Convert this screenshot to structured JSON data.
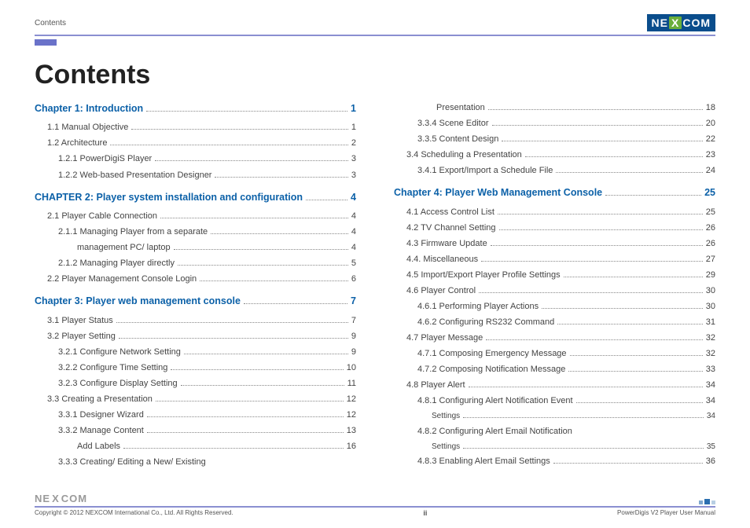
{
  "header": {
    "label": "Contents"
  },
  "logo": {
    "pre": "NE",
    "x": "X",
    "post": "COM"
  },
  "title": "Contents",
  "toc_left": [
    {
      "label": "Chapter 1: Introduction",
      "page": "1",
      "cls": "chapter"
    },
    {
      "label": "1.1 Manual Objective",
      "page": "1",
      "cls": "lvl1"
    },
    {
      "label": "1.2 Architecture",
      "page": "2",
      "cls": "lvl1"
    },
    {
      "label": "1.2.1 PowerDigiS Player",
      "page": "3",
      "cls": "lvl2"
    },
    {
      "label": "1.2.2 Web-based Presentation Designer",
      "page": "3",
      "cls": "lvl2"
    },
    {
      "label": "CHAPTER 2: Player system installation and configuration",
      "page": "4",
      "cls": "chapter"
    },
    {
      "label": "2.1 Player Cable Connection",
      "page": "4",
      "cls": "lvl1"
    },
    {
      "label": "2.1.1 Managing Player from a separate",
      "page": "4",
      "cls": "lvl2"
    },
    {
      "label": "management PC/ laptop",
      "page": "4",
      "cls": "lvl3"
    },
    {
      "label": "2.1.2 Managing Player directly",
      "page": "5",
      "cls": "lvl2"
    },
    {
      "label": "2.2 Player Management Console Login",
      "page": "6",
      "cls": "lvl1"
    },
    {
      "label": "Chapter 3: Player web management console",
      "page": "7",
      "cls": "chapter"
    },
    {
      "label": "3.1 Player Status",
      "page": "7",
      "cls": "lvl1"
    },
    {
      "label": "3.2 Player Setting",
      "page": "9",
      "cls": "lvl1"
    },
    {
      "label": "3.2.1 Configure Network Setting",
      "page": "9",
      "cls": "lvl2"
    },
    {
      "label": "3.2.2 Configure Time Setting",
      "page": "10",
      "cls": "lvl2"
    },
    {
      "label": "3.2.3 Configure Display Setting",
      "page": "11",
      "cls": "lvl2"
    },
    {
      "label": "3.3 Creating a Presentation",
      "page": "12",
      "cls": "lvl1"
    },
    {
      "label": "3.3.1 Designer Wizard",
      "page": "12",
      "cls": "lvl2"
    },
    {
      "label": "3.3.2 Manage Content",
      "page": "13",
      "cls": "lvl2"
    },
    {
      "label": "Add Labels",
      "page": "16",
      "cls": "lvl3"
    },
    {
      "label": "3.3.3 Creating/ Editing a New/ Existing",
      "page": "",
      "cls": "lvl2"
    }
  ],
  "toc_right": [
    {
      "label": "Presentation",
      "page": "18",
      "cls": "lvl3"
    },
    {
      "label": "3.3.4 Scene Editor",
      "page": "20",
      "cls": "lvl2"
    },
    {
      "label": "3.3.5 Content Design",
      "page": "22",
      "cls": "lvl2"
    },
    {
      "label": "3.4 Scheduling a Presentation",
      "page": "23",
      "cls": "lvl1"
    },
    {
      "label": "3.4.1 Export/Import a Schedule File",
      "page": "24",
      "cls": "lvl2"
    },
    {
      "label": "Chapter 4: Player Web Management Console",
      "page": "25",
      "cls": "chapter"
    },
    {
      "label": "4.1 Access Control List",
      "page": "25",
      "cls": "lvl1"
    },
    {
      "label": "4.2 TV Channel Setting",
      "page": "26",
      "cls": "lvl1"
    },
    {
      "label": "4.3 Firmware Update",
      "page": "26",
      "cls": "lvl1"
    },
    {
      "label": "4.4. Miscellaneous",
      "page": "27",
      "cls": "lvl1"
    },
    {
      "label": "4.5 Import/Export Player Profile Settings",
      "page": "29",
      "cls": "lvl1"
    },
    {
      "label": "4.6 Player Control",
      "page": "30",
      "cls": "lvl1"
    },
    {
      "label": "4.6.1 Performing Player Actions",
      "page": "30",
      "cls": "lvl2"
    },
    {
      "label": "4.6.2 Configuring RS232 Command",
      "page": "31",
      "cls": "lvl2"
    },
    {
      "label": "4.7 Player Message",
      "page": "32",
      "cls": "lvl1"
    },
    {
      "label": "4.7.1 Composing Emergency Message",
      "page": "32",
      "cls": "lvl2"
    },
    {
      "label": "4.7.2 Composing Notification Message",
      "page": "33",
      "cls": "lvl2"
    },
    {
      "label": "4.8 Player Alert",
      "page": "34",
      "cls": "lvl1"
    },
    {
      "label": "4.8.1 Configuring Alert Notification Event",
      "page": "34",
      "cls": "lvl2"
    },
    {
      "label": "Settings",
      "page": "34",
      "cls": "lvl2s"
    },
    {
      "label": "4.8.2 Configuring Alert Email Notification",
      "page": "",
      "cls": "lvl2"
    },
    {
      "label": "Settings",
      "page": "35",
      "cls": "lvl2s"
    },
    {
      "label": "4.8.3 Enabling Alert Email Settings",
      "page": "36",
      "cls": "lvl2"
    }
  ],
  "footer": {
    "copyright": "Copyright © 2012 NEXCOM International Co., Ltd. All Rights Reserved.",
    "page": "ii",
    "doc": "PowerDigis V2 Player User Manual"
  }
}
